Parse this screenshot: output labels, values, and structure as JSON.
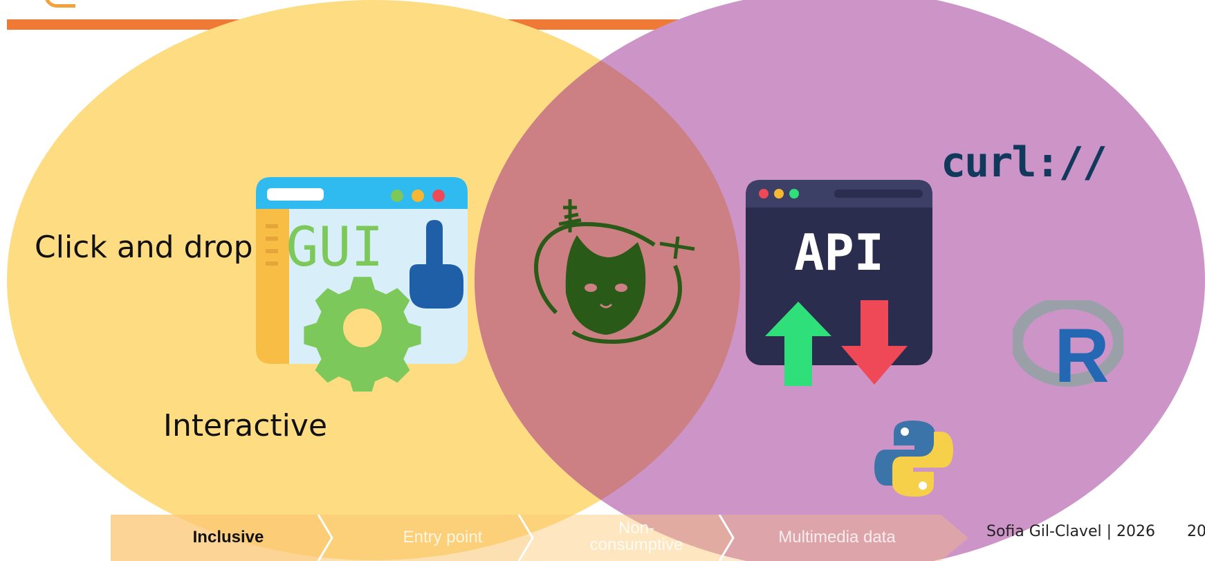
{
  "venn": {
    "left_circle": {
      "color": "#fdd97c",
      "label_top": "Click and drop",
      "label_bottom": "Interactive",
      "icon": "gui-window-icon",
      "icon_text": "GUI"
    },
    "right_circle": {
      "color": "#cc93c8",
      "icon": "api-window-icon",
      "icon_text": "API",
      "logos": [
        "curl-logo",
        "r-logo",
        "python-logo"
      ],
      "curl_text": "curl://",
      "r_text": "R"
    },
    "overlap": {
      "color": "#cc8084",
      "icon": "cat-in-orbit-icon"
    }
  },
  "header": {
    "accent_color": "#ee7a36"
  },
  "process_steps": [
    {
      "label": "Inclusive",
      "active": true
    },
    {
      "label": "Entry point",
      "active": false
    },
    {
      "label": "Non-consumptive",
      "active": false
    },
    {
      "label": "Multimedia data",
      "active": false
    }
  ],
  "footer": {
    "author": "Sofia Gil-Clavel | 2026",
    "page_number": "20"
  }
}
